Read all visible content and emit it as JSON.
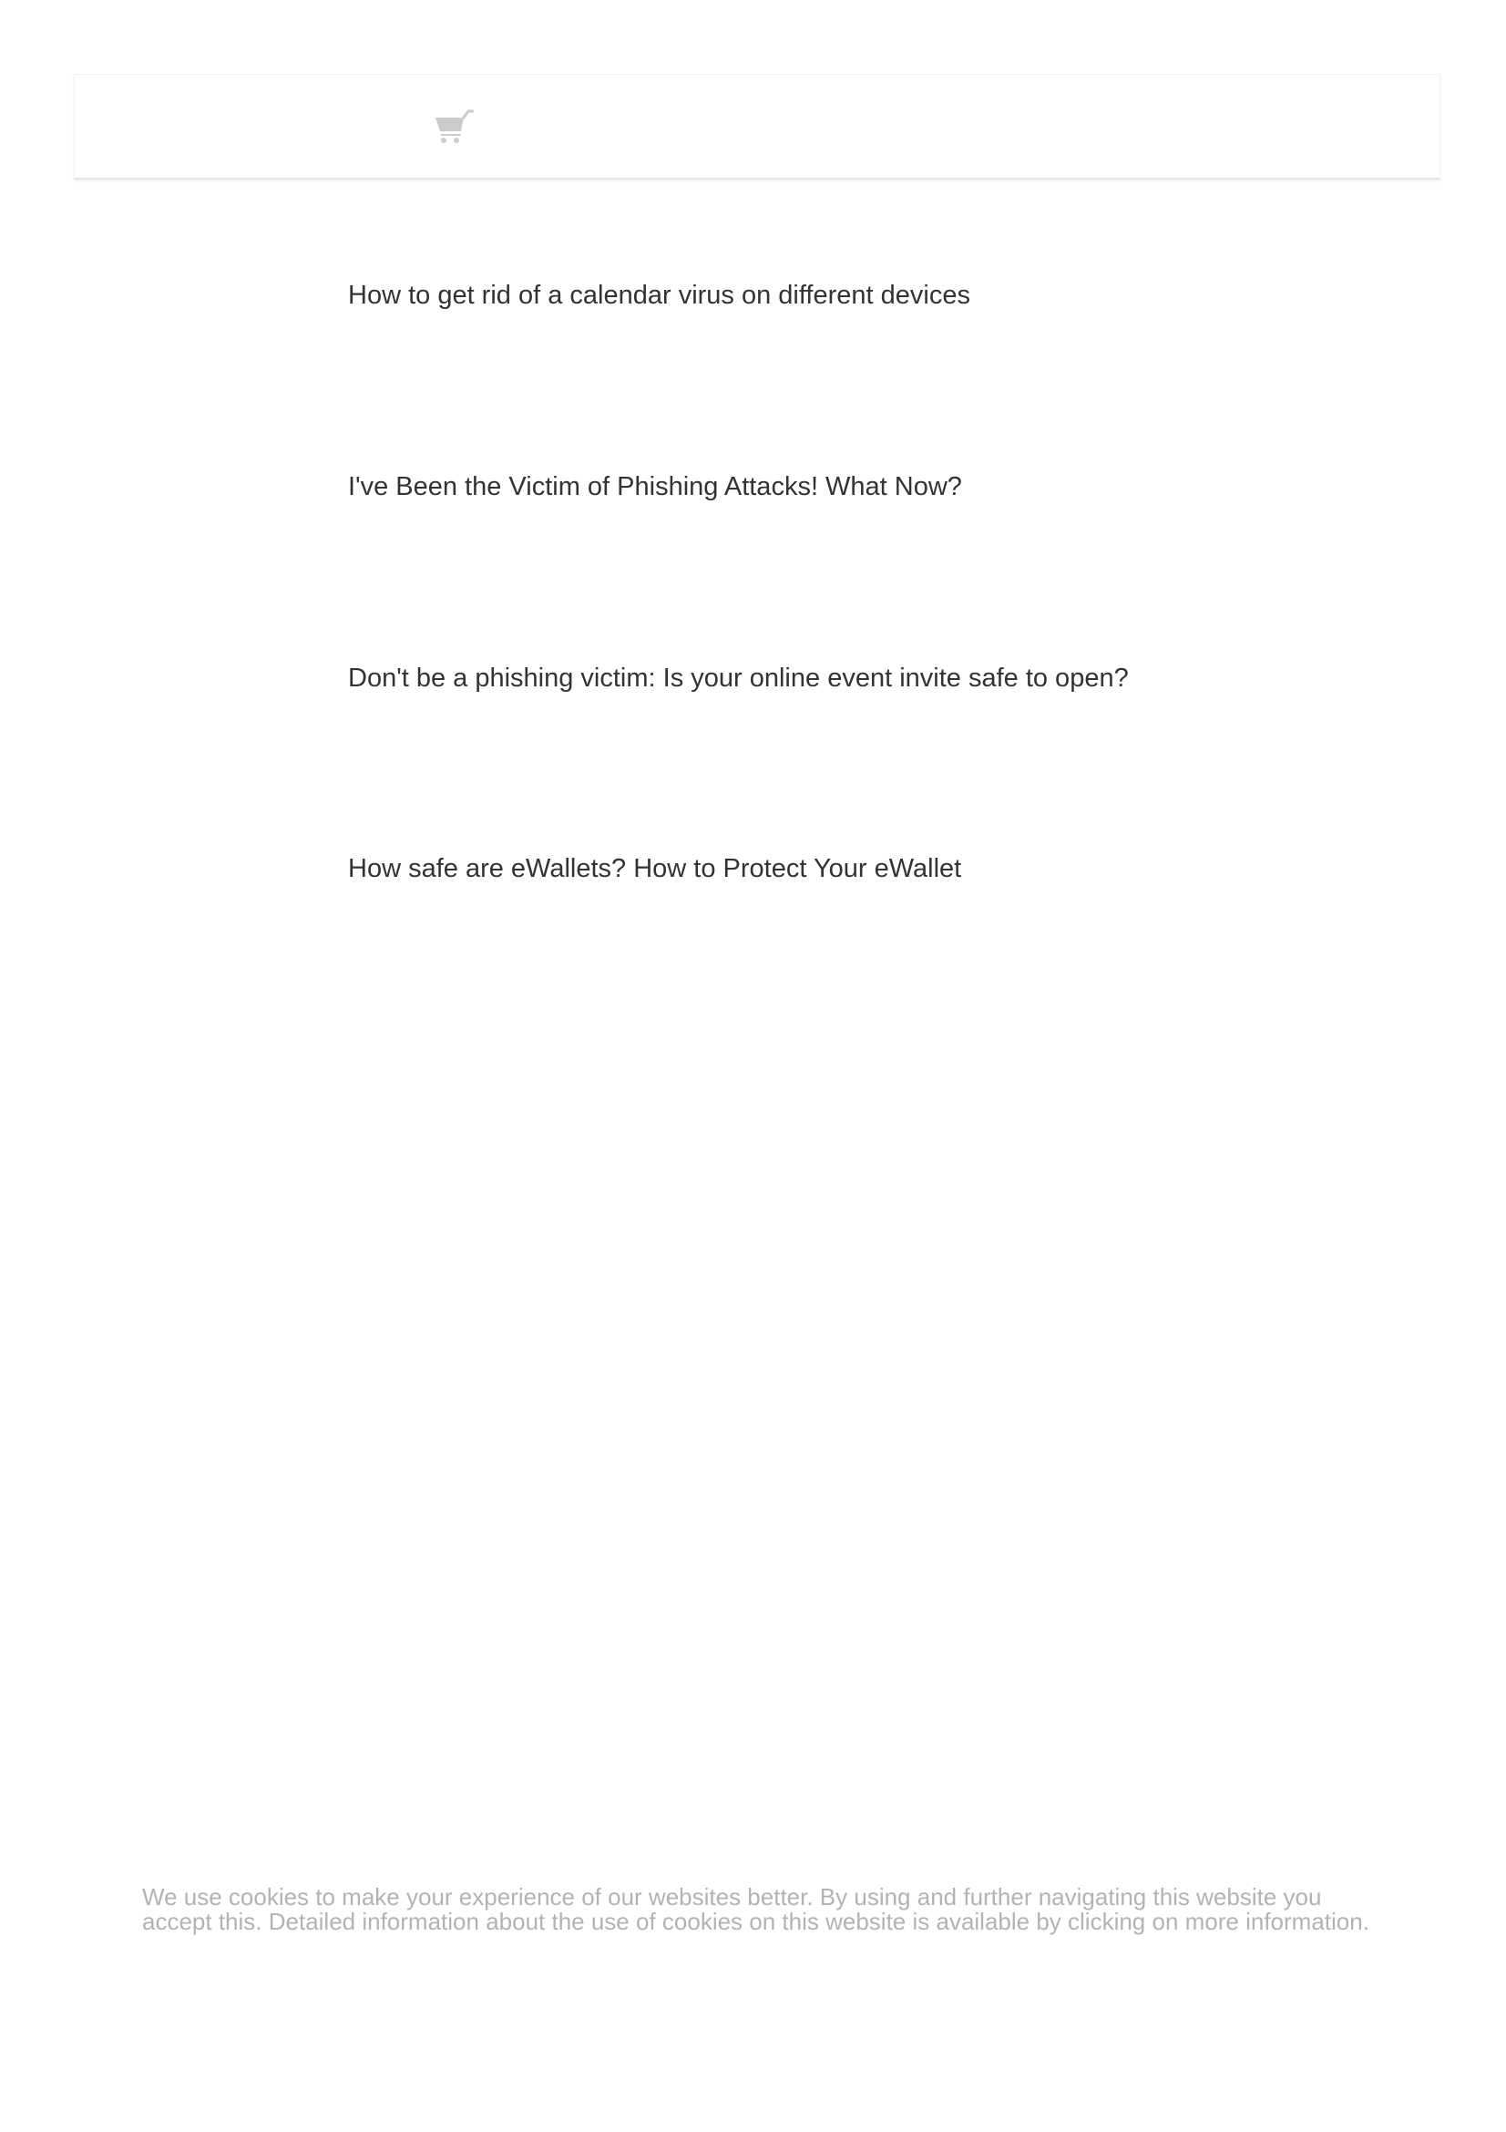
{
  "header": {
    "cart_icon": "shopping-cart-icon"
  },
  "articles": [
    {
      "title": "How to get rid of a calendar virus on different devices"
    },
    {
      "title": "I've Been the Victim of Phishing Attacks! What Now?"
    },
    {
      "title": "Don't be a phishing victim: Is your online event invite safe to open?"
    },
    {
      "title": "How safe are eWallets? How to Protect Your eWallet"
    }
  ],
  "cookie_notice": {
    "text": "We use cookies to make your experience of our websites better. By using and further navigating this website you accept this. Detailed information about the use of cookies on this website is available by clicking on more information."
  },
  "colors": {
    "text": "#333333",
    "muted": "#b3b3b3",
    "icon": "#cccccc"
  }
}
